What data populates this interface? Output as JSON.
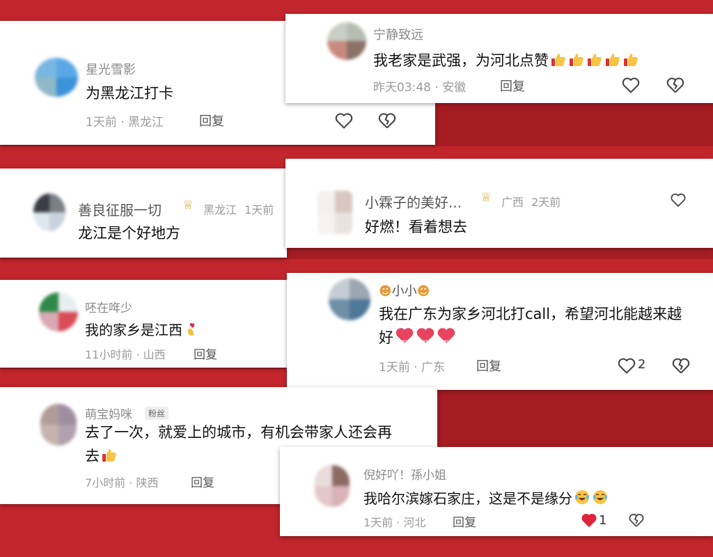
{
  "colors": {
    "background": "#a51c22",
    "heart_liked": "#e0243b",
    "meta": "#9a9a9a"
  },
  "reply_label": "回复",
  "comments": [
    {
      "name": "星光雪影",
      "text": "为黑龙江打卡",
      "time": "1天前",
      "location": "黑龙江"
    },
    {
      "name": "宁静致远",
      "text": "我老家是武强，为河北点赞",
      "time": "昨天03:48",
      "location": "安徽",
      "emoji": "thumbs-up-icon",
      "emoji_count": 5
    },
    {
      "name": "善良征服一切",
      "text": "龙江是个好地方",
      "location": "黑龙江",
      "time": "1天前",
      "badge_icon": "crown-icon"
    },
    {
      "name": "小霖子的美好...",
      "text": "好燃！看着想去",
      "location": "广西",
      "time": "2天前",
      "badge_icon": "crown-icon"
    },
    {
      "name": "呸在哖少",
      "text": "我的家乡是江西",
      "time": "11小时前",
      "location": "山西",
      "emoji": "finger-heart-icon"
    },
    {
      "name": "小小",
      "text": "我在广东为家乡河北打call，希望河北能越来越好",
      "time": "1天前",
      "location": "广东",
      "likes": "2",
      "emoji": "jiayou-heart-icon",
      "emoji_count": 3,
      "emoji_label": "加油"
    },
    {
      "name": "萌宝妈咪",
      "badge": "粉丝",
      "text": "去了一次，就爱上的城市，有机会带家人还会再去",
      "time": "7小时前",
      "location": "陕西",
      "emoji": "thumbs-up-icon"
    },
    {
      "name": "倪好吖！孫小姐",
      "text": "我哈尔滨嫁石家庄，这是不是缘分",
      "time": "1天前",
      "location": "河北",
      "likes": "1",
      "emoji": "crying-laughing-icon",
      "emoji_count": 2
    }
  ]
}
